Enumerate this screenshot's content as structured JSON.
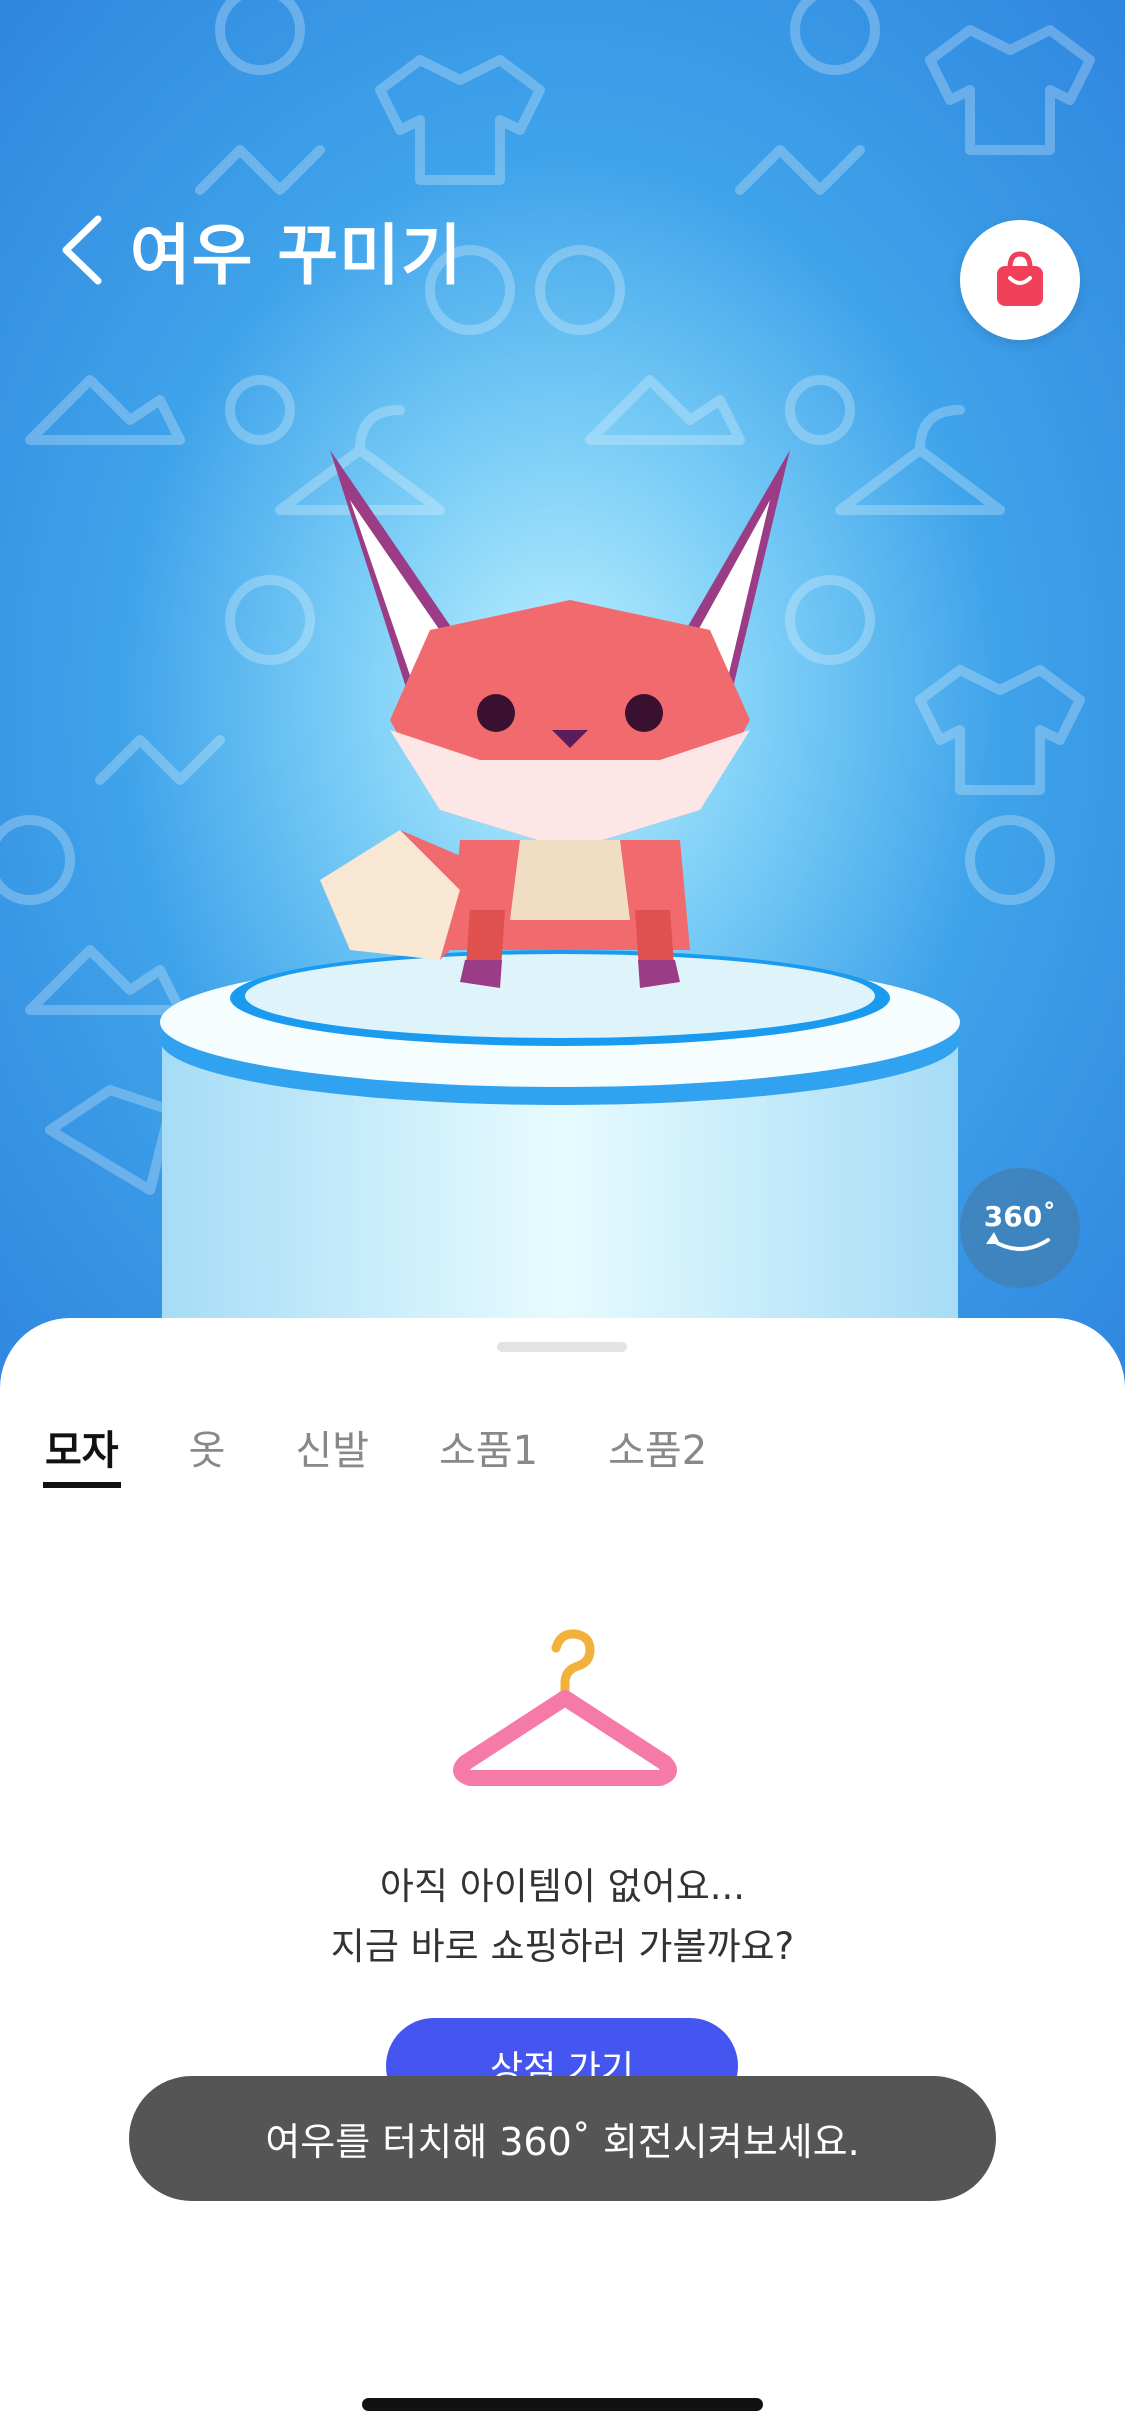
{
  "header": {
    "title": "여우 꾸미기",
    "back_icon": "chevron-left-icon",
    "shop_icon": "shopping-bag-icon"
  },
  "rotate_button": {
    "label": "360˚",
    "icon": "rotate-360-icon"
  },
  "tabs": [
    {
      "label": "모자",
      "active": true
    },
    {
      "label": "옷",
      "active": false
    },
    {
      "label": "신발",
      "active": false
    },
    {
      "label": "소품1",
      "active": false
    },
    {
      "label": "소품2",
      "active": false
    }
  ],
  "empty_state": {
    "line1": "아직 아이템이 없어요...",
    "line2": "지금 바로 쇼핑하러 가볼까요?",
    "button_label": "상점 가기",
    "icon": "hanger-icon"
  },
  "toast": {
    "text": "여우를 터치해 360˚ 회전시켜보세요."
  },
  "colors": {
    "accent": "#4455F0",
    "shop_bag": "#F0405A",
    "sky": "#3FA3EA",
    "toast_bg": "#555555"
  }
}
